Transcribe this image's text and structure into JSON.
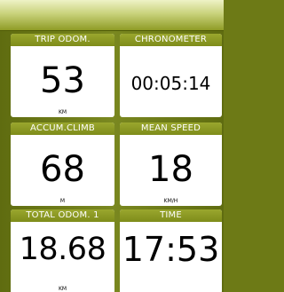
{
  "tiles": [
    {
      "label": "TRIP ODOM.",
      "value": "53",
      "unit": "KM"
    },
    {
      "label": "CHRONOMETER",
      "value": "00:05:14",
      "unit": ""
    },
    {
      "label": "ACCUM.CLIMB",
      "value": "68",
      "unit": "M"
    },
    {
      "label": "MEAN SPEED",
      "value": "18",
      "unit": "KM/H"
    },
    {
      "label": "TOTAL ODOM. 1",
      "value": "18.68",
      "unit": "KM"
    },
    {
      "label": "TIME",
      "value": "17:53",
      "unit": ""
    }
  ],
  "colors": {
    "background": "#6d7a16",
    "header": "#8a9724",
    "tile": "#ffffff",
    "text": "#000000"
  }
}
